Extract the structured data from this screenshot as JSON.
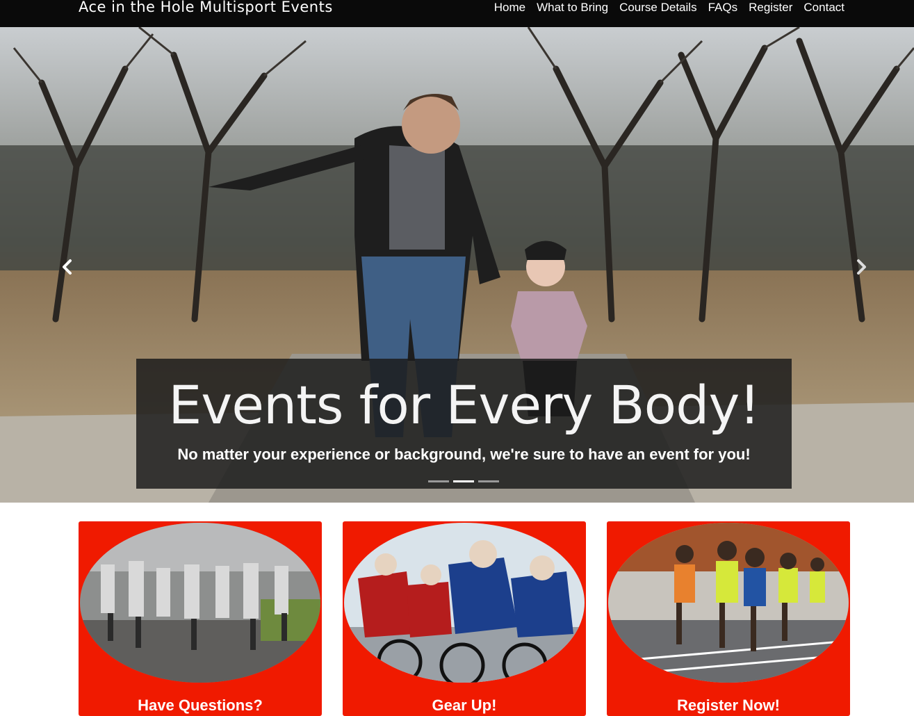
{
  "navbar": {
    "brand": "Ace in the Hole Multisport Events",
    "links": [
      "Home",
      "What to Bring",
      "Course Details",
      "FAQs",
      "Register",
      "Contact"
    ]
  },
  "hero": {
    "title": "Events for Every Body!",
    "subtitle": "No matter your experience or background, we're sure to have an event for you!",
    "slide_count": 3,
    "active_slide": 2,
    "prev_icon": "chevron-left-icon",
    "next_icon": "chevron-right-icon"
  },
  "cards": [
    {
      "title": "Have Questions?"
    },
    {
      "title": "Gear Up!"
    },
    {
      "title": "Register Now!"
    }
  ],
  "colors": {
    "navbar": "#0a0a0a",
    "card": "#f01a00",
    "caption_bg": "rgba(28,28,28,0.85)"
  }
}
